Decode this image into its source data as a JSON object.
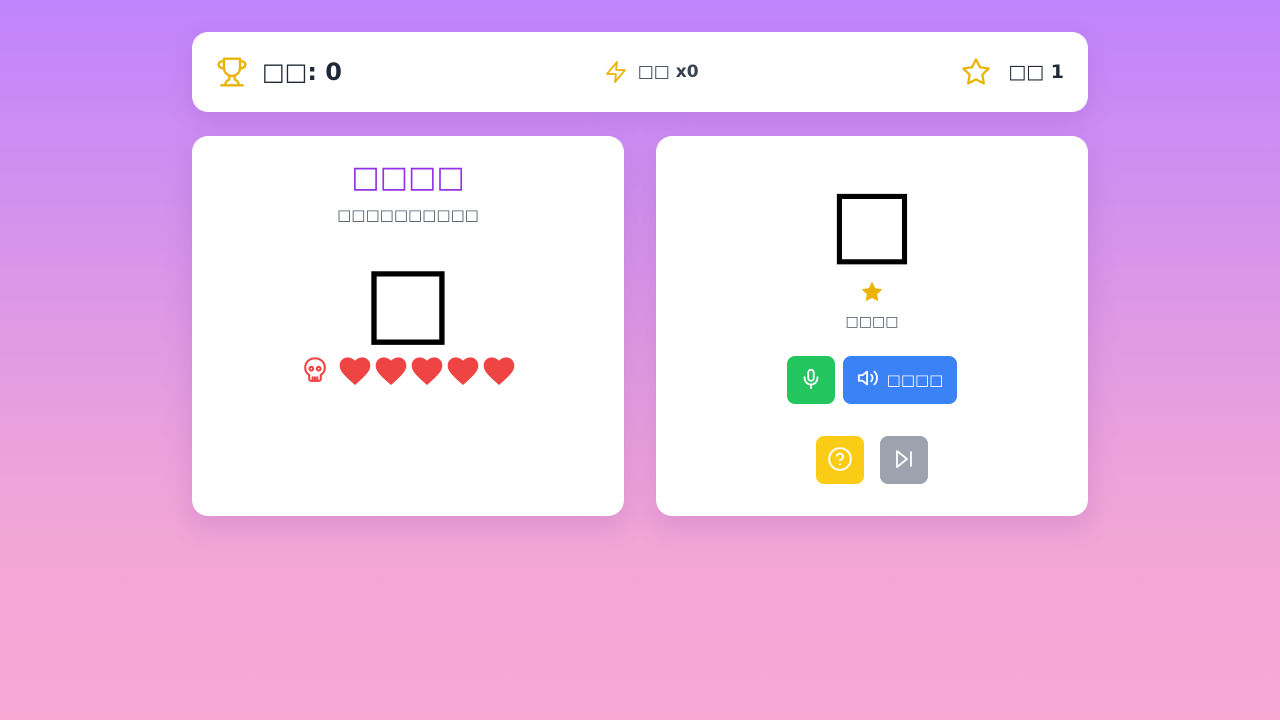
{
  "header": {
    "score_label": "□□: 0",
    "combo_label": "□□ x0",
    "level_label": "□□ 1",
    "icons": [
      "trophy-icon",
      "lightning-icon",
      "star-outline-icon"
    ]
  },
  "boss": {
    "name": "□□□□",
    "subtitle": "□□□□□□□□□□",
    "emoji": "□",
    "health": {
      "current": 5,
      "max": 5
    },
    "icons": [
      "skull-icon",
      "heart-icon"
    ]
  },
  "character": {
    "emoji": "□",
    "caption": "□□□□",
    "speak_label": "□□□□",
    "icons": [
      "star-icon",
      "microphone-icon",
      "speaker-icon",
      "help-icon",
      "skip-icon"
    ]
  },
  "colors": {
    "accent_purple": "#9333ea",
    "heart_red": "#ef4444",
    "gold": "#eab308",
    "mic_green": "#22c55e",
    "speak_blue": "#3b82f6",
    "hint_yellow": "#facc15",
    "skip_gray": "#9ca3af"
  }
}
